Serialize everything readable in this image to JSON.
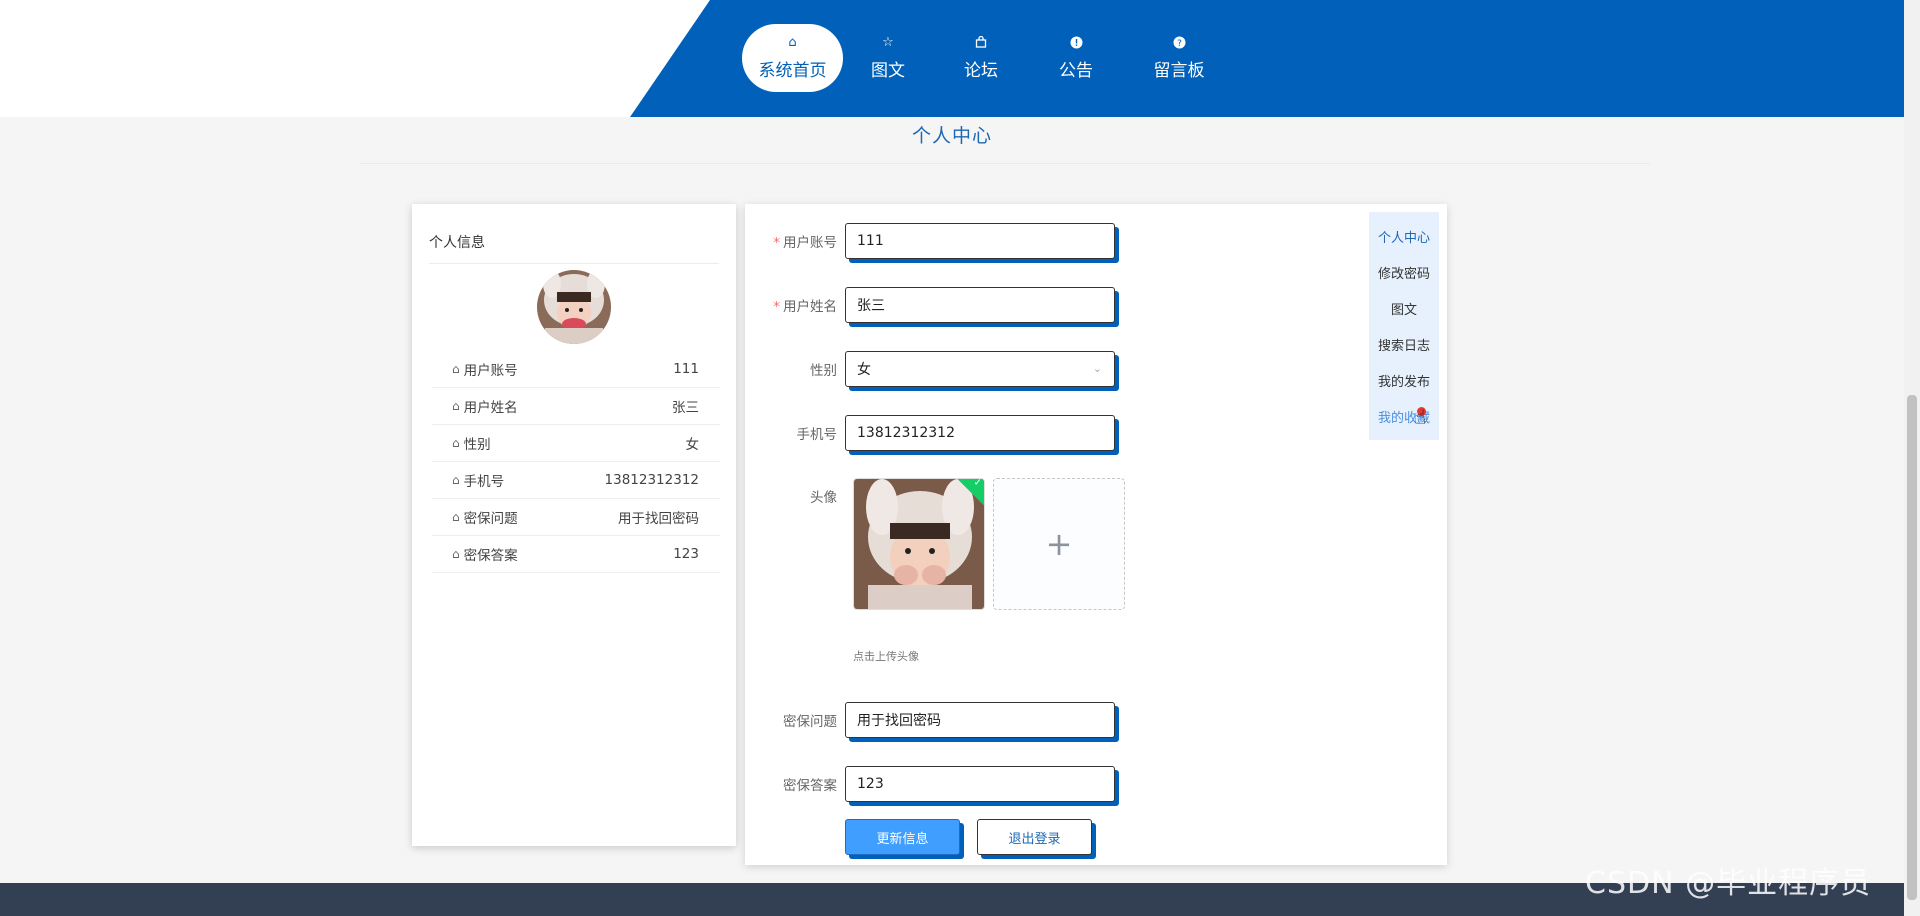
{
  "nav": {
    "items": [
      {
        "label": "系统首页",
        "icon": "home-icon"
      },
      {
        "label": "图文",
        "icon": "star-icon"
      },
      {
        "label": "论坛",
        "icon": "bag-icon"
      },
      {
        "label": "公告",
        "icon": "alert-icon"
      },
      {
        "label": "留言板",
        "icon": "question-icon"
      }
    ],
    "active_index": 0
  },
  "page_title": "个人中心",
  "info_card": {
    "title": "个人信息",
    "rows": [
      {
        "label": "用户账号",
        "value": "111"
      },
      {
        "label": "用户姓名",
        "value": "张三"
      },
      {
        "label": "性别",
        "value": "女"
      },
      {
        "label": "手机号",
        "value": "13812312312"
      },
      {
        "label": "密保问题",
        "value": "用于找回密码"
      },
      {
        "label": "密保答案",
        "value": "123"
      }
    ]
  },
  "form": {
    "account": {
      "label": "用户账号",
      "value": "111",
      "required": "*"
    },
    "name": {
      "label": "用户姓名",
      "value": "张三",
      "required": "*"
    },
    "gender": {
      "label": "性别",
      "value": "女"
    },
    "phone": {
      "label": "手机号",
      "value": "13812312312"
    },
    "avatar": {
      "label": "头像",
      "tip": "点击上传头像"
    },
    "question": {
      "label": "密保问题",
      "value": "用于找回密码"
    },
    "answer": {
      "label": "密保答案",
      "value": "123"
    },
    "update_label": "更新信息",
    "logout_label": "退出登录"
  },
  "side_menu": [
    "个人中心",
    "修改密码",
    "图文",
    "搜索日志",
    "我的发布",
    "我的收藏"
  ],
  "watermark": "CSDN @毕业程序员",
  "colors": {
    "brand": "#0160b9",
    "primary_button": "#409eff",
    "footer": "#333f52"
  }
}
